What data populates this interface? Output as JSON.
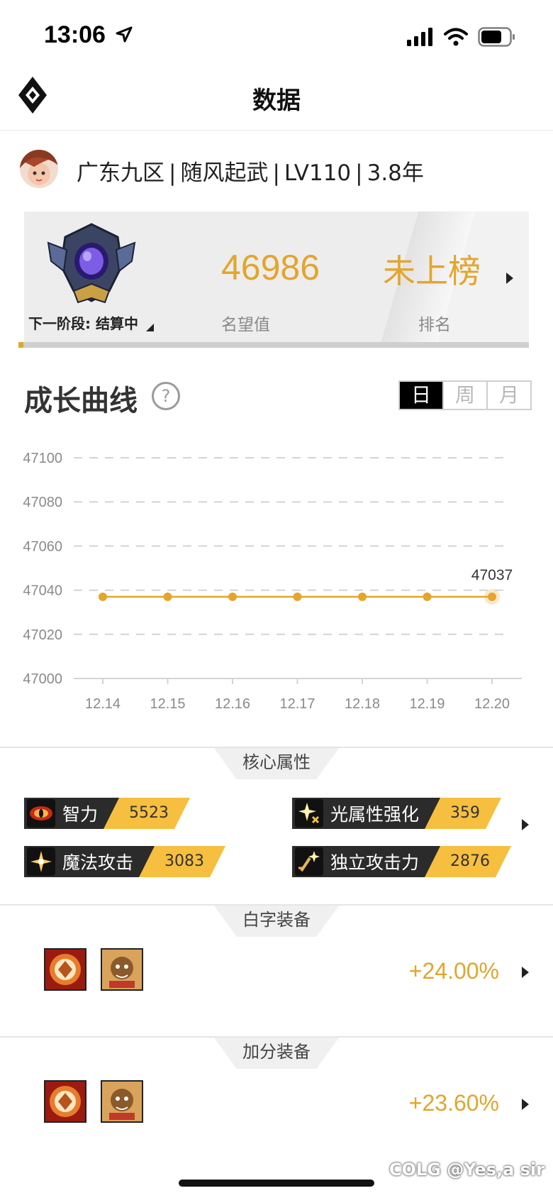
{
  "status_bar": {
    "time": "13:06"
  },
  "nav": {
    "title": "数据"
  },
  "profile": {
    "server": "广东九区",
    "character": "随风起武",
    "level": "LV110",
    "years": "3.8年"
  },
  "rank_card": {
    "next_stage": "下一阶段: 结算中",
    "fame_value": "46986",
    "fame_label": "名望值",
    "rank_value": "未上榜",
    "rank_label": "排名",
    "progress_fraction": 0.01
  },
  "growth": {
    "title": "成长曲线",
    "help_icon": "?",
    "tabs": [
      "日",
      "周",
      "月"
    ],
    "active_tab": 0
  },
  "chart_data": {
    "type": "line",
    "title": "",
    "x": [
      "12.14",
      "12.15",
      "12.16",
      "12.17",
      "12.18",
      "12.19",
      "12.20"
    ],
    "series": [
      {
        "values": [
          47037,
          47037,
          47037,
          47037,
          47037,
          47037,
          47037
        ]
      }
    ],
    "yticks": [
      47000,
      47020,
      47040,
      47060,
      47080,
      47100
    ],
    "ylim": [
      47000,
      47100
    ],
    "last_label": "47037",
    "grid": true,
    "color": "#e3a52c"
  },
  "core_attributes": {
    "section_title": "核心属性",
    "items": [
      {
        "label": "智力",
        "value": "5523",
        "icon": "eye-icon"
      },
      {
        "label": "光属性强化",
        "value": "359",
        "icon": "light-sparkle-icon"
      },
      {
        "label": "魔法攻击",
        "value": "3083",
        "icon": "magic-sparkle-icon"
      },
      {
        "label": "独立攻击力",
        "value": "2876",
        "icon": "sword-sparkle-icon"
      }
    ]
  },
  "white_equipment": {
    "section_title": "白字装备",
    "percent": "+24.00%"
  },
  "bonus_equipment": {
    "section_title": "加分装备",
    "percent": "+23.60%"
  },
  "watermark": "COLG @Yes,a sir",
  "colors": {
    "accent": "#e3a52c",
    "attr_value_bg": "#f6bf3f",
    "dark": "#2b2b2b"
  }
}
